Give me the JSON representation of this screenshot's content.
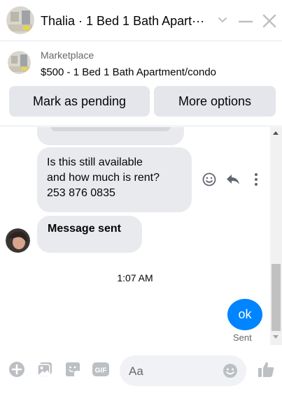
{
  "header": {
    "title": "Thalia · 1 Bed 1 Bath Apart···"
  },
  "marketplace": {
    "label": "Marketplace",
    "listing": "$500 - 1 Bed 1 Bath Apartment/condo",
    "buttons": {
      "pending": "Mark as pending",
      "more": "More options"
    }
  },
  "messages": {
    "msg1": [
      "Is this still available",
      "and how much is rent?",
      "253 876 0835"
    ],
    "msg2": "Message sent",
    "timestamp": "1:07 AM",
    "outgoing": "ok",
    "status": "Sent"
  },
  "composer": {
    "placeholder": "Aa"
  },
  "colors": {
    "accent": "#0084ff",
    "bubble": "#e9eaed",
    "button": "#e4e6eb",
    "icon": "#bcc0c4"
  },
  "icons": [
    "chevron-down-icon",
    "minimize-icon",
    "close-icon",
    "smile-icon",
    "reply-icon",
    "more-vertical-icon",
    "add-icon",
    "photo-icon",
    "sticker-icon",
    "gif-icon",
    "emoji-icon",
    "like-icon"
  ]
}
